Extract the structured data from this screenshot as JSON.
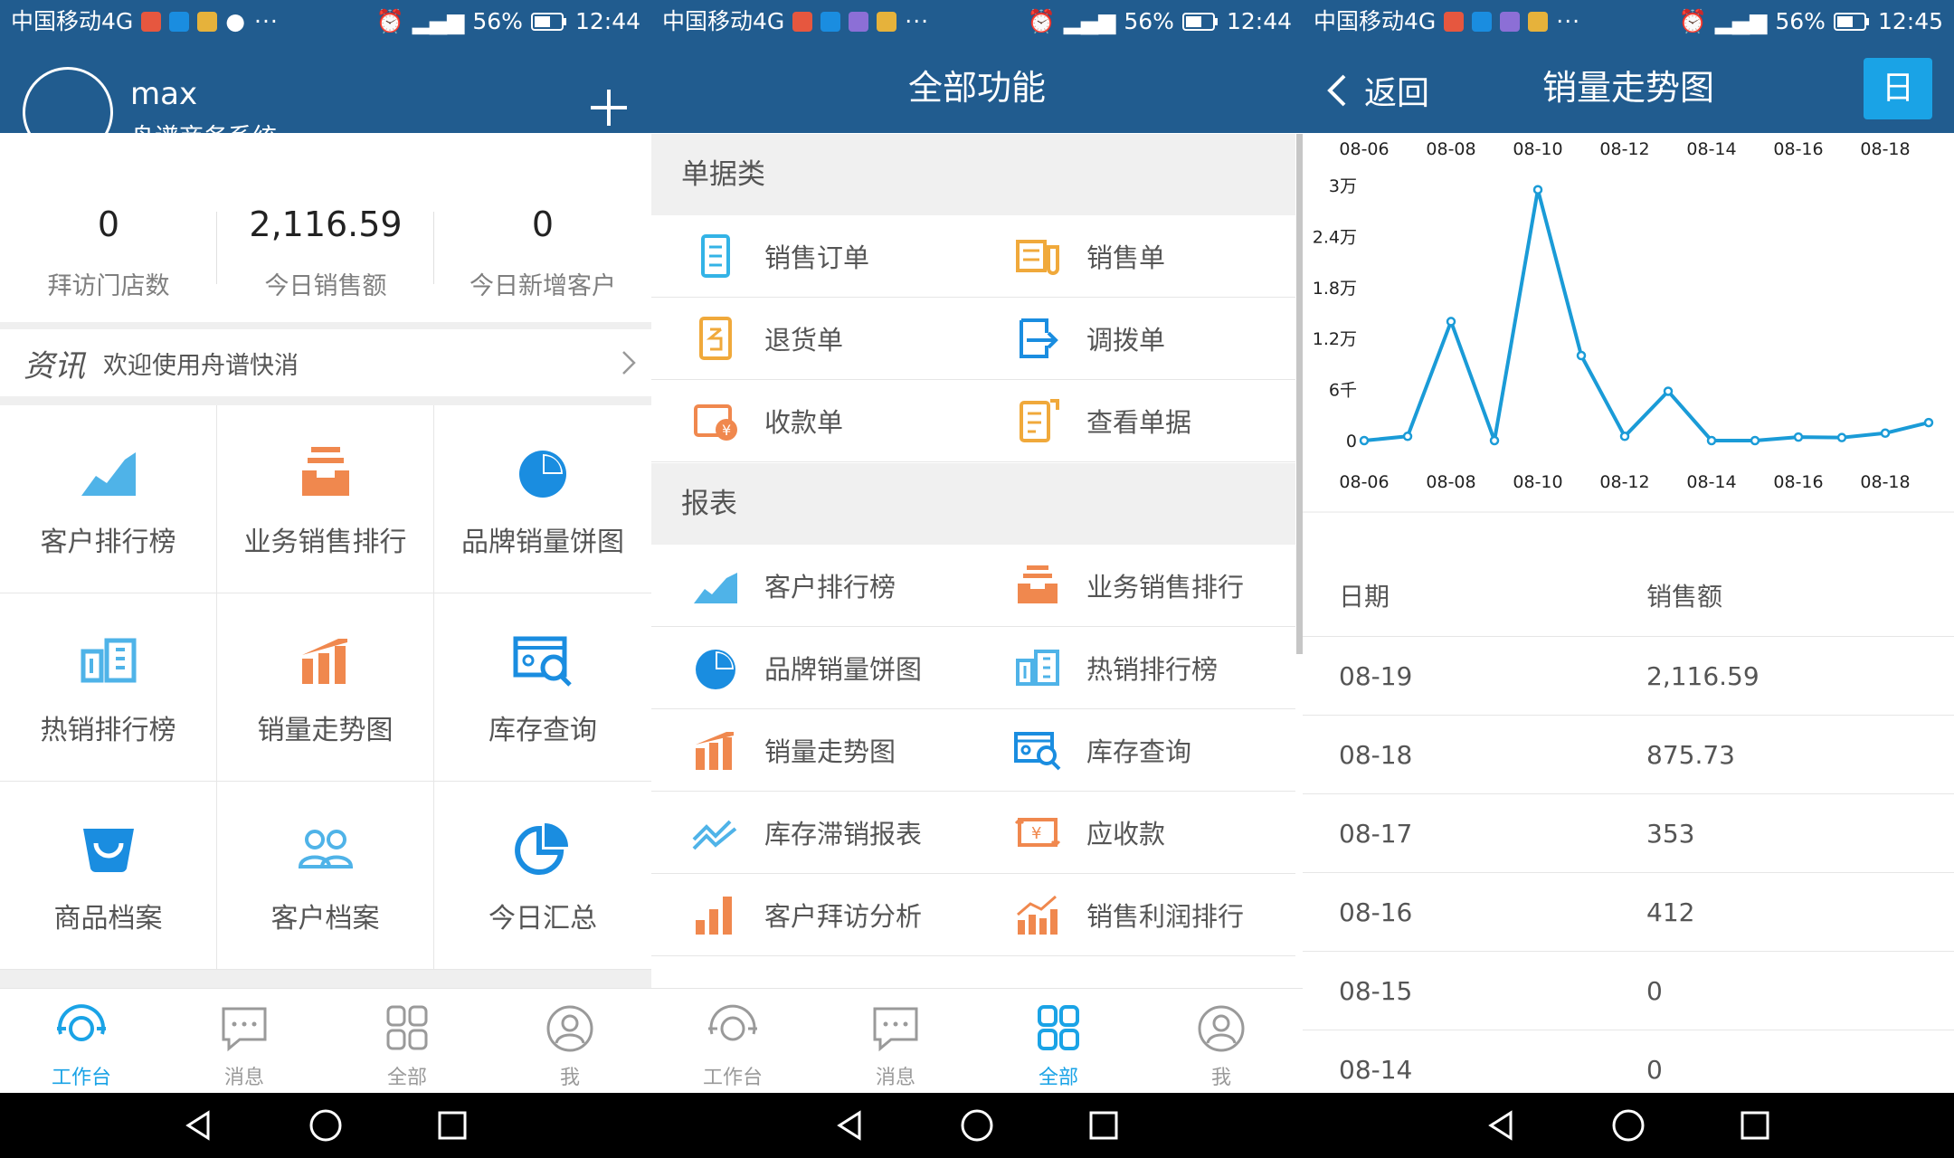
{
  "status_bars": [
    {
      "carrier": "中国移动4G",
      "battery": "56%",
      "time": "12:44"
    },
    {
      "carrier": "中国移动4G",
      "battery": "56%",
      "time": "12:44"
    },
    {
      "carrier": "中国移动4G",
      "battery": "56%",
      "time": "12:45"
    }
  ],
  "workbench": {
    "user_name": "max",
    "company": "舟谱商务系统",
    "stats": [
      {
        "value": "0",
        "label": "拜访门店数"
      },
      {
        "value": "2,116.59",
        "label": "今日销售额"
      },
      {
        "value": "0",
        "label": "今日新增客户"
      }
    ],
    "news": {
      "tag": "资讯",
      "text": "欢迎使用舟谱快消"
    },
    "grid": [
      {
        "label": "客户排行榜",
        "icon": "area-chart-icon"
      },
      {
        "label": "业务销售排行",
        "icon": "tray-stack-icon"
      },
      {
        "label": "品牌销量饼图",
        "icon": "pie-chart-icon"
      },
      {
        "label": "热销排行榜",
        "icon": "hot-rank-icon"
      },
      {
        "label": "销量走势图",
        "icon": "bar-trend-icon"
      },
      {
        "label": "库存查询",
        "icon": "inventory-search-icon"
      },
      {
        "label": "商品档案",
        "icon": "product-basket-icon"
      },
      {
        "label": "客户档案",
        "icon": "customers-icon"
      },
      {
        "label": "今日汇总",
        "icon": "summary-pie-icon"
      }
    ]
  },
  "all_functions": {
    "title": "全部功能",
    "sections": [
      {
        "title": "单据类",
        "items": [
          "销售订单",
          "销售单",
          "退货单",
          "调拨单",
          "收款单",
          "查看单据"
        ]
      },
      {
        "title": "报表",
        "items": [
          "客户排行榜",
          "业务销售排行",
          "品牌销量饼图",
          "热销排行榜",
          "销量走势图",
          "库存查询",
          "库存滞销报表",
          "应收款",
          "客户拜访分析",
          "销售利润排行"
        ]
      }
    ]
  },
  "trend": {
    "back_label": "返回",
    "title": "销量走势图",
    "period_button": "日",
    "table_headers": [
      "日期",
      "销售额"
    ],
    "rows": [
      {
        "date": "08-19",
        "amount": "2,116.59"
      },
      {
        "date": "08-18",
        "amount": "875.73"
      },
      {
        "date": "08-17",
        "amount": "353"
      },
      {
        "date": "08-16",
        "amount": "412"
      },
      {
        "date": "08-15",
        "amount": "0"
      },
      {
        "date": "08-14",
        "amount": "0"
      }
    ]
  },
  "tabs": [
    "工作台",
    "消息",
    "全部",
    "我"
  ],
  "colors": {
    "header": "#215c8f",
    "accent": "#1aa3e6",
    "orange": "#f0884e"
  },
  "chart_data": {
    "type": "line",
    "x": [
      "08-06",
      "08-07",
      "08-08",
      "08-09",
      "08-10",
      "08-11",
      "08-12",
      "08-13",
      "08-14",
      "08-15",
      "08-16",
      "08-17",
      "08-18",
      "08-19"
    ],
    "tick_labels": [
      "08-06",
      "08-08",
      "08-10",
      "08-12",
      "08-14",
      "08-16",
      "08-18"
    ],
    "y_ticks": [
      "0",
      "6千",
      "1.2万",
      "1.8万",
      "2.4万",
      "3万"
    ],
    "values": [
      0,
      500,
      14000,
      0,
      29500,
      10000,
      500,
      5800,
      0,
      0,
      412,
      353,
      875.73,
      2116.59
    ],
    "ylim": [
      0,
      30000
    ],
    "grid": false
  }
}
